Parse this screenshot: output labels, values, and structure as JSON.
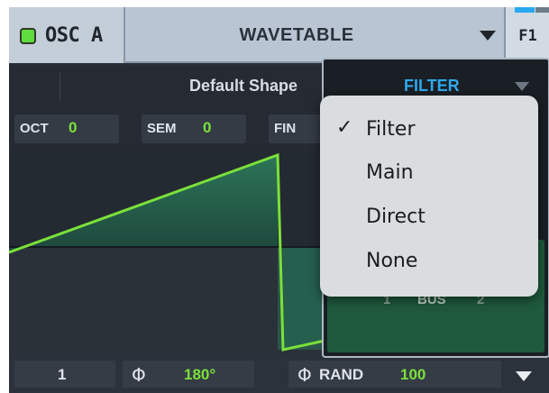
{
  "header": {
    "osc_title": "OSC A",
    "osc_enabled": true,
    "wavetable_name": "WAVETABLE",
    "fx_tab_label": "F1"
  },
  "shape_row": {
    "shape_name": "Default Shape"
  },
  "params": [
    {
      "label": "OCT",
      "value": "0"
    },
    {
      "label": "SEM",
      "value": "0"
    },
    {
      "label": "FIN",
      "value": ""
    }
  ],
  "bottom_row": {
    "unison_value": "1",
    "phase_value": "180°",
    "rand_label": "RAND",
    "rand_value": "100"
  },
  "filter_panel": {
    "selected": "FILTER",
    "bus_label": "BUS",
    "bus_left": "1",
    "bus_right": "2"
  },
  "dropdown": {
    "items": [
      {
        "label": "Filter",
        "checked": true
      },
      {
        "label": "Main",
        "checked": false
      },
      {
        "label": "Direct",
        "checked": false
      },
      {
        "label": "None",
        "checked": false
      }
    ]
  },
  "icons": {
    "phase_symbol": "Φ",
    "check_symbol": "✓"
  },
  "colors": {
    "accent_green": "#7be03a",
    "accent_blue": "#2fa8ec",
    "led_green": "#5fdc3e"
  }
}
